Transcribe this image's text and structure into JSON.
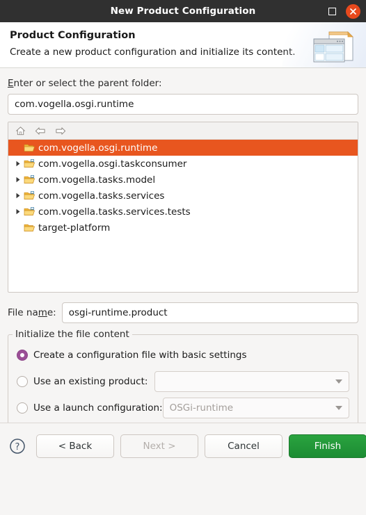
{
  "window": {
    "title": "New Product Configuration",
    "maximize_icon": "maximize-square-icon",
    "close_icon": "close-x-icon",
    "close_color": "#e8491d",
    "titlebar_color": "#303030"
  },
  "header": {
    "title": "Product Configuration",
    "description": "Create a new product configuration and initialize its content.",
    "icon": "product-configuration-window-document-icon"
  },
  "parent_folder": {
    "label_before": "E",
    "label_after": "nter or select the parent folder:",
    "value": "com.vogella.osgi.runtime",
    "placeholder": ""
  },
  "tree_toolbar": {
    "home_icon": "home-icon",
    "back_icon": "back-arrow-icon",
    "forward_icon": "forward-arrow-icon"
  },
  "tree": {
    "selection_color": "#e8561f",
    "items": [
      {
        "label": "com.vogella.osgi.runtime",
        "expandable": false,
        "selected": true,
        "icon": "folder-open-icon"
      },
      {
        "label": "com.vogella.osgi.taskconsumer",
        "expandable": true,
        "selected": false,
        "icon": "folder-project-icon"
      },
      {
        "label": "com.vogella.tasks.model",
        "expandable": true,
        "selected": false,
        "icon": "folder-project-icon"
      },
      {
        "label": "com.vogella.tasks.services",
        "expandable": true,
        "selected": false,
        "icon": "folder-project-icon"
      },
      {
        "label": "com.vogella.tasks.services.tests",
        "expandable": true,
        "selected": false,
        "icon": "folder-project-icon"
      },
      {
        "label": "target-platform",
        "expandable": false,
        "selected": false,
        "icon": "folder-open-icon"
      }
    ]
  },
  "file_name": {
    "label_before": "File na",
    "label_mnemonic": "m",
    "label_after": "e:",
    "value": "osgi-runtime.product"
  },
  "initialize_group": {
    "legend": "Initialize the file content",
    "accent_color": "#9b4f96",
    "options": [
      {
        "label_before": "C",
        "label_mnemonic": "C",
        "label_full": "Create a configuration file with basic settings",
        "checked": true,
        "has_combo": false,
        "combo_value": ""
      },
      {
        "label_full": "Use an existing product:",
        "label_mnemonic": "U",
        "checked": false,
        "has_combo": true,
        "combo_value": ""
      },
      {
        "label_full": "Use a launch configuration:",
        "label_mnemonic": "s",
        "checked": false,
        "has_combo": true,
        "combo_value": "OSGi-runtime"
      }
    ]
  },
  "footer": {
    "help_icon": "help-question-icon",
    "back_label": "< Back",
    "next_label": "Next >",
    "next_disabled": true,
    "cancel_label": "Cancel",
    "finish_label": "Finish",
    "finish_color": "#1c8c33"
  }
}
